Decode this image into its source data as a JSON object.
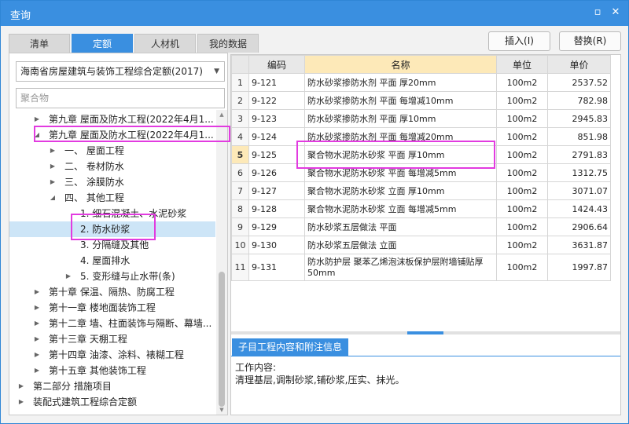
{
  "window": {
    "title": "查询",
    "min_icon": "maximize-icon",
    "close_icon": "close-icon"
  },
  "tabs": [
    {
      "label": "清单",
      "active": false
    },
    {
      "label": "定额",
      "active": true
    },
    {
      "label": "人材机",
      "active": false
    },
    {
      "label": "我的数据",
      "active": false
    }
  ],
  "buttons": {
    "insert": "插入(I)",
    "replace": "替换(R)"
  },
  "left": {
    "quota_select": "海南省房屋建筑与装饰工程综合定额(2017)",
    "search_value": "聚合物",
    "tree": [
      {
        "label": "第九章 屋面及防水工程(2022年4月1...",
        "toggle": "▶"
      },
      {
        "label": "第九章 屋面及防水工程(2022年4月1...",
        "toggle": "◢"
      },
      {
        "label": "一、 屋面工程",
        "toggle": "▶"
      },
      {
        "label": "二、 卷材防水",
        "toggle": "▶"
      },
      {
        "label": "三、 涂膜防水",
        "toggle": "▶"
      },
      {
        "label": "四、 其他工程",
        "toggle": "◢"
      },
      {
        "label": "1. 细石混凝土、水泥砂浆",
        "toggle": ""
      },
      {
        "label": "2. 防水砂浆",
        "toggle": ""
      },
      {
        "label": "3. 分隔缝及其他",
        "toggle": ""
      },
      {
        "label": "4. 屋面排水",
        "toggle": ""
      },
      {
        "label": "5. 变形缝与止水带(条)",
        "toggle": "▶"
      },
      {
        "label": "第十章 保温、隔热、防腐工程",
        "toggle": "▶"
      },
      {
        "label": "第十一章 楼地面装饰工程",
        "toggle": "▶"
      },
      {
        "label": "第十二章 墙、柱面装饰与隔断、幕墙...",
        "toggle": "▶"
      },
      {
        "label": "第十三章 天棚工程",
        "toggle": "▶"
      },
      {
        "label": "第十四章 油漆、涂料、裱糊工程",
        "toggle": "▶"
      },
      {
        "label": "第十五章 其他装饰工程",
        "toggle": "▶"
      },
      {
        "label": "第二部分 措施项目",
        "toggle": "▶"
      },
      {
        "label": "装配式建筑工程综合定额",
        "toggle": "▶"
      }
    ]
  },
  "grid": {
    "headers": {
      "code": "编码",
      "name": "名称",
      "unit": "单位",
      "price": "单价"
    },
    "rows": [
      {
        "no": "1",
        "code": "9-121",
        "name": "防水砂浆掺防水剂 平面 厚20mm",
        "unit": "100m2",
        "price": "2537.52"
      },
      {
        "no": "2",
        "code": "9-122",
        "name": "防水砂浆掺防水剂 平面 每增减10mm",
        "unit": "100m2",
        "price": "782.98"
      },
      {
        "no": "3",
        "code": "9-123",
        "name": "防水砂浆掺防水剂 平面 厚10mm",
        "unit": "100m2",
        "price": "2945.83"
      },
      {
        "no": "4",
        "code": "9-124",
        "name": "防水砂浆掺防水剂 平面 每增减20mm",
        "unit": "100m2",
        "price": "851.98"
      },
      {
        "no": "5",
        "code": "9-125",
        "name": "聚合物水泥防水砂浆 平面 厚10mm",
        "unit": "100m2",
        "price": "2791.83"
      },
      {
        "no": "6",
        "code": "9-126",
        "name": "聚合物水泥防水砂浆 平面 每增减5mm",
        "unit": "100m2",
        "price": "1312.75"
      },
      {
        "no": "7",
        "code": "9-127",
        "name": "聚合物水泥防水砂浆 立面 厚10mm",
        "unit": "100m2",
        "price": "3071.07"
      },
      {
        "no": "8",
        "code": "9-128",
        "name": "聚合物水泥防水砂浆 立面 每增减5mm",
        "unit": "100m2",
        "price": "1424.43"
      },
      {
        "no": "9",
        "code": "9-129",
        "name": "防水砂浆五层做法 平面",
        "unit": "100m2",
        "price": "2906.64"
      },
      {
        "no": "10",
        "code": "9-130",
        "name": "防水砂浆五层做法 立面",
        "unit": "100m2",
        "price": "3631.87"
      },
      {
        "no": "11",
        "code": "9-131",
        "name": "防水防护层 聚苯乙烯泡沫板保护层附墙铺贴厚50mm",
        "unit": "100m2",
        "price": "1997.87"
      }
    ]
  },
  "bottom": {
    "tab_label": "子目工程内容和附注信息",
    "work_title": "工作内容:",
    "work_text": "清理基层,调制砂浆,铺砂浆,压实、抹光。"
  },
  "colors": {
    "accent": "#3a8fe0",
    "highlight": "#e23be0",
    "selected_row": "#cde5f7",
    "name_header": "#fde9b8"
  }
}
